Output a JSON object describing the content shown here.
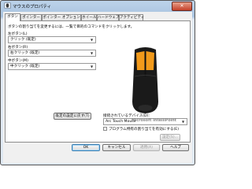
{
  "window": {
    "title": "マウスのプロパティ",
    "close_label": "✕"
  },
  "tabs": [
    "ボタン",
    "ポインター",
    "ポインター オプション",
    "ホイール",
    "ハードウェア",
    "アクティビティ"
  ],
  "active_tab": "ボタン",
  "buttons_tab": {
    "description": "ボタンの割り当てを変更するには、一覧で目的のコマンドをクリックします。",
    "left_button": {
      "label": "左ボタン(L)",
      "value": "クリック (既定)"
    },
    "right_button": {
      "label": "右ボタン(R)",
      "value": "右クリック (既定)"
    },
    "middle_button": {
      "label": "中ボタン(M)",
      "value": "中クリック (既定)"
    },
    "connected_device_label": "接続されているデバイス(D):",
    "connected_device_value": "Arc Touch Mouse",
    "program_specific_label": "プログラム特有の割り当てを有効にする(E)",
    "program_specific_checked": false,
    "settings_button": "設定(S)...",
    "reset_button": "既定の設定に戻す(T)",
    "brand_prefix": "Microsoft",
    "brand_name": "IntelliPoint"
  },
  "footer": {
    "ok": "OK",
    "cancel": "キャンセル",
    "apply": "適用(A)",
    "help": "ヘルプ"
  },
  "colors": {
    "accent_orange": "#f29a1b",
    "mouse_body": "#1a1a1a",
    "title_bar": "#a9c3df"
  }
}
